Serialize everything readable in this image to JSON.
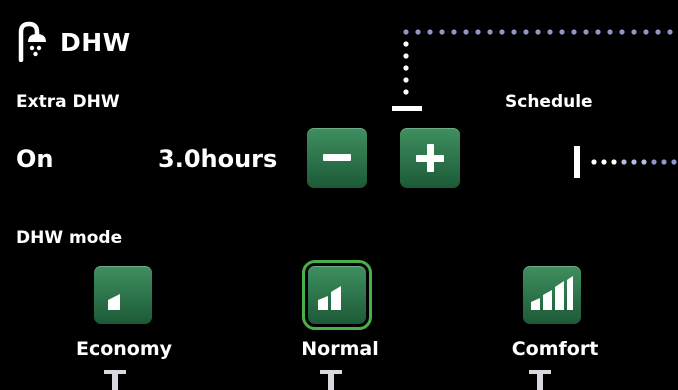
{
  "header": {
    "title": "DHW",
    "icon": "shower-icon"
  },
  "extra_dhw": {
    "label": "Extra DHW",
    "state": "On",
    "duration": "3.0hours"
  },
  "buttons": {
    "decrease": "minus-icon",
    "increase": "plus-icon"
  },
  "schedule": {
    "label": "Schedule"
  },
  "dhw_mode": {
    "label": "DHW mode",
    "selected": "Normal",
    "options": [
      {
        "label": "Economy",
        "level": 1
      },
      {
        "label": "Normal",
        "level": 2
      },
      {
        "label": "Comfort",
        "level": 3
      }
    ]
  },
  "colors": {
    "button_green": "#2e7a4d",
    "selection_outline": "#4bb04a",
    "dotted_line": "#8f97c8"
  }
}
